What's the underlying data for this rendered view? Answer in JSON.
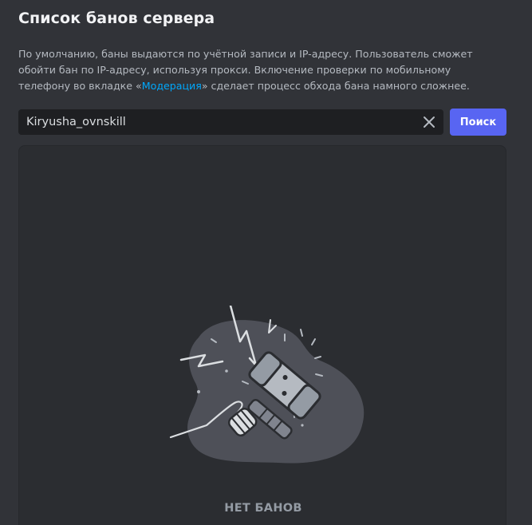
{
  "header": {
    "title": "Список банов сервера"
  },
  "description": {
    "text_before_link": "По умолчанию, баны выдаются по учётной записи и IP-адресу. Пользователь сможет обойти бан по IP-адресу, используя прокси. Включение проверки по мобильному телефону во вкладке «",
    "link_text": "Модерация",
    "text_after_link": "» сделает процесс обхода бана намного сложнее."
  },
  "search": {
    "value": "Kiryusha_ovnskill",
    "placeholder": "",
    "button_label": "Поиск",
    "clear_icon": "close-icon"
  },
  "ban_list": {
    "empty_text": "НЕТ БАНОВ",
    "illustration_icon": "ban-hammer-icon"
  },
  "colors": {
    "background": "#313338",
    "panel": "#2b2d31",
    "input_background": "#1e1f22",
    "accent": "#5865f2",
    "link": "#00a8fc",
    "muted_text": "#949ba4"
  }
}
